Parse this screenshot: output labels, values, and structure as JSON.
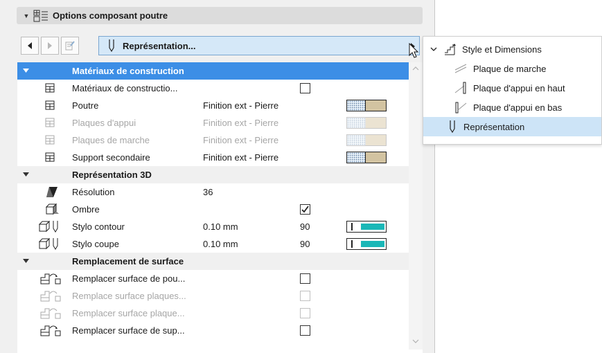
{
  "header": {
    "title": "Options composant poutre",
    "collapse_icon": "triangle-down-icon",
    "settings_icon": "grid-settings-icon"
  },
  "toolbar": {
    "prev_icon": "triangle-left-icon",
    "next_icon": "triangle-right-icon",
    "edit_icon": "edit-document-icon",
    "representation_label": "Représentation...",
    "representation_icon": "pen-icon"
  },
  "groups": {
    "materials": "Matériaux de construction",
    "rep3d": "Représentation 3D",
    "surface": "Remplacement de surface"
  },
  "materials_rows": [
    {
      "name": "Matériaux de constructio...",
      "value": "",
      "checkbox": false,
      "enabled": true
    },
    {
      "name": "Poutre",
      "value": "Finition ext - Pierre",
      "enabled": true
    },
    {
      "name": "Plaques d'appui",
      "value": "Finition ext - Pierre",
      "enabled": false
    },
    {
      "name": "Plaques de marche",
      "value": "Finition ext - Pierre",
      "enabled": false
    },
    {
      "name": "Support secondaire",
      "value": "Finition ext - Pierre",
      "enabled": true
    }
  ],
  "rep3d_rows": [
    {
      "name": "Résolution",
      "value": "36"
    },
    {
      "name": "Ombre",
      "checked": true
    },
    {
      "name": "Stylo contour",
      "value": "0.10 mm",
      "number": "90"
    },
    {
      "name": "Stylo coupe",
      "value": "0.10 mm",
      "number": "90"
    }
  ],
  "surface_rows": [
    {
      "name": "Remplacer surface de pou...",
      "enabled": true
    },
    {
      "name": "Remplace surface plaques...",
      "enabled": false
    },
    {
      "name": "Remplacer surface plaque...",
      "enabled": false
    },
    {
      "name": "Remplacer surface de sup...",
      "enabled": true
    }
  ],
  "popup": {
    "parent": "Style et Dimensions",
    "items": [
      {
        "label": "Plaque de marche",
        "icon": "tread-plate-icon"
      },
      {
        "label": "Plaque d'appui en haut",
        "icon": "top-support-plate-icon"
      },
      {
        "label": "Plaque d'appui en bas",
        "icon": "bottom-support-plate-icon"
      },
      {
        "label": "Représentation",
        "icon": "pen-icon",
        "selected": true
      }
    ]
  },
  "colors": {
    "selection_blue": "#3c8ee6",
    "select_field": "#d5e8f8",
    "pen_teal": "#1ab7b7",
    "stone": "#d2c3a1"
  }
}
